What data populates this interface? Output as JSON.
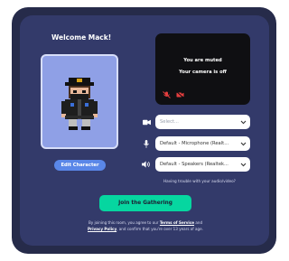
{
  "welcome": "Welcome Mack!",
  "edit_character": "Edit Character",
  "video": {
    "muted_text": "You are muted",
    "camera_off_text": "Your camera is off"
  },
  "devices": {
    "camera": {
      "value": "Select...",
      "icon": "video-camera-icon"
    },
    "microphone": {
      "value": "Default - Microphone (Realt...",
      "icon": "microphone-icon"
    },
    "speakers": {
      "value": "Default - Speakers (Realtek...",
      "icon": "speaker-icon"
    }
  },
  "trouble_link": "Having trouble with your audio/video?",
  "join_button": "Join the Gathering",
  "legal": {
    "prefix": "By joining this room, you agree to our",
    "tos": "Terms of Service",
    "and": "and",
    "privacy": "Privacy Policy",
    "suffix": ", and confirm that you're over 13 years of age."
  },
  "colors": {
    "outer_panel": "#262b4a",
    "inner_panel": "#333a6a",
    "join_button": "#06d6a0",
    "edit_button": "#5a87e8",
    "muted_icons": "#e53e3e"
  }
}
